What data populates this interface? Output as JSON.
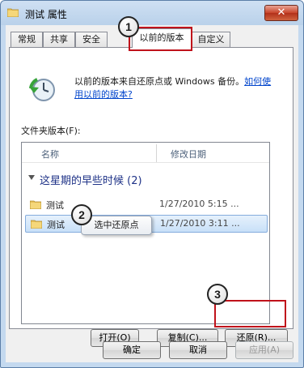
{
  "window": {
    "title": "测试 属性",
    "close_symbol": "✕"
  },
  "tabs": [
    {
      "label": "常规",
      "active": false
    },
    {
      "label": "共享",
      "active": false
    },
    {
      "label": "安全",
      "active": false
    },
    {
      "label": "以前的版本",
      "active": true
    },
    {
      "label": "自定义",
      "active": false
    }
  ],
  "intro": {
    "text": "以前的版本来自还原点或 Windows 备份。",
    "link": "如何使用以前的版本?"
  },
  "folder_versions_label": "文件夹版本(F):",
  "list": {
    "columns": [
      "名称",
      "修改日期"
    ],
    "group": "这星期的早些时候 (2)",
    "rows": [
      {
        "name": "测试",
        "date": "1/27/2010 5:15 ...",
        "selected": false
      },
      {
        "name": "测试",
        "date": "1/27/2010 3:11 ...",
        "selected": true
      }
    ]
  },
  "callout": "选中还原点",
  "markers": [
    "1",
    "2",
    "3"
  ],
  "buttons": {
    "open": "打开(O)",
    "copy": "复制(C)...",
    "restore": "还原(R)...",
    "ok": "确定",
    "cancel": "取消",
    "apply": "应用(A)"
  },
  "colors": {
    "highlight": "#c0121b",
    "link": "#0044cc",
    "group_title": "#1e3287"
  },
  "icons": [
    "folder-icon",
    "close-icon",
    "system-restore-icon",
    "expand-arrow-icon"
  ]
}
